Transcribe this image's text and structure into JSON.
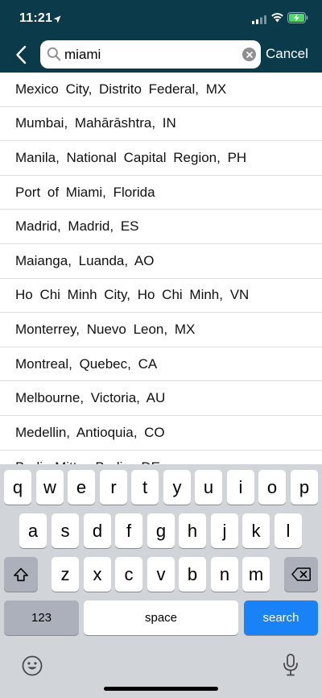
{
  "status": {
    "time": "11:21"
  },
  "search": {
    "value": "miami",
    "cancel_label": "Cancel"
  },
  "results": [
    "Mexico City, Distrito Federal, MX",
    "Mumbai, Mahārāshtra, IN",
    "Manila, National Capital Region, PH",
    "Port of Miami, Florida",
    "Madrid, Madrid, ES",
    "Maianga, Luanda, AO",
    "Ho Chi Minh City, Ho Chi Minh, VN",
    "Monterrey, Nuevo Leon, MX",
    "Montreal, Quebec, CA",
    "Melbourne, Victoria, AU",
    "Medellin, Antioquia, CO",
    "Berlin-Mitte, Berlin, DE"
  ],
  "keyboard": {
    "row1": [
      "q",
      "w",
      "e",
      "r",
      "t",
      "y",
      "u",
      "i",
      "o",
      "p"
    ],
    "row2": [
      "a",
      "s",
      "d",
      "f",
      "g",
      "h",
      "j",
      "k",
      "l"
    ],
    "row3": [
      "z",
      "x",
      "c",
      "v",
      "b",
      "n",
      "m"
    ],
    "numbers_label": "123",
    "space_label": "space",
    "search_label": "search"
  },
  "colors": {
    "header_bg": "#0b3a4b",
    "search_key": "#1a82f7",
    "battery": "#4cd964"
  }
}
